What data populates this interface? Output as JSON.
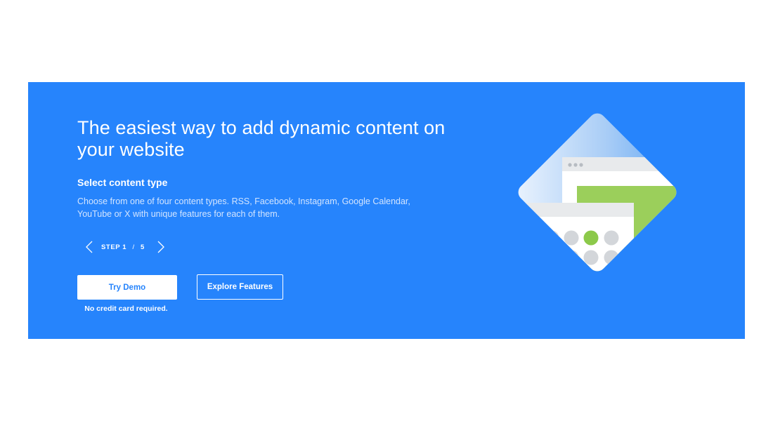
{
  "hero": {
    "headline": "The easiest way to add dynamic content on your website",
    "subheading": "Select content type",
    "description": "Choose from one of four content types. RSS, Facebook, Instagram, Google Calendar, YouTube or X with unique features for each of them.",
    "stepper": {
      "label": "STEP",
      "current": "1",
      "separator": "/",
      "total": "5"
    },
    "buttons": {
      "try_demo": "Try Demo",
      "explore_features": "Explore Features"
    },
    "note": "No credit card required."
  },
  "colors": {
    "background": "#2684fc",
    "accent_green": "#9bcf5b",
    "card_gray": "#e8eaec",
    "dot_gray": "#d3d6da"
  },
  "icons": [
    "chevron-left-icon",
    "chevron-right-icon"
  ]
}
